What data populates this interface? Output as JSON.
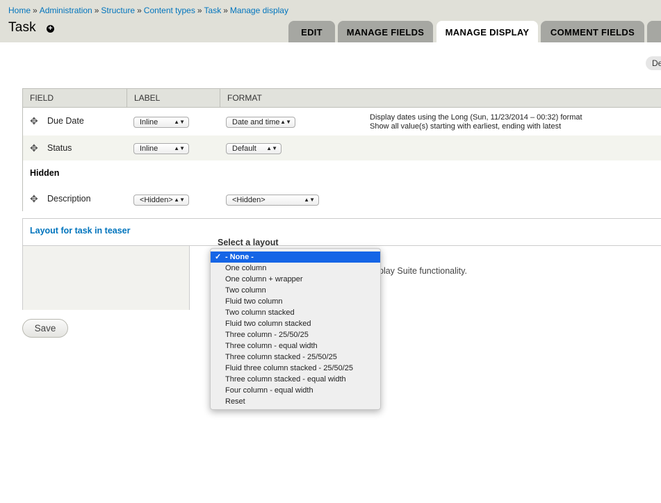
{
  "breadcrumb": [
    {
      "label": "Home"
    },
    {
      "label": "Administration"
    },
    {
      "label": "Structure"
    },
    {
      "label": "Content types"
    },
    {
      "label": "Task"
    },
    {
      "label": "Manage display"
    }
  ],
  "breadcrumb_separator": "»",
  "page": {
    "title": "Task",
    "add_shortcut_icon": "plus-circle-icon"
  },
  "tabs": [
    {
      "label": "EDIT",
      "active": false
    },
    {
      "label": "MANAGE FIELDS",
      "active": false
    },
    {
      "label": "MANAGE DISPLAY",
      "active": true
    },
    {
      "label": "COMMENT FIELDS",
      "active": false
    }
  ],
  "secondary_tab": {
    "label": "De"
  },
  "table": {
    "headers": [
      "FIELD",
      "LABEL",
      "FORMAT"
    ],
    "rows": [
      {
        "name": "Due Date",
        "label_value": "Inline",
        "format_value": "Date and time",
        "summary": [
          "Display dates using the Long (Sun, 11/23/2014 – 00:32) format",
          "Show all value(s) starting with earliest, ending with latest"
        ]
      },
      {
        "name": "Status",
        "label_value": "Inline",
        "format_value": "Default",
        "summary": []
      }
    ],
    "hidden_heading": "Hidden",
    "hidden_rows": [
      {
        "name": "Description",
        "label_value": "<Hidden>",
        "format_value": "<Hidden>"
      }
    ],
    "drag_icon": "move-cross-icon"
  },
  "layout": {
    "legend": "Layout for task in teaser",
    "select_label": "Select a layout",
    "help_text": "play Suite functionality."
  },
  "save_label": "Save",
  "dropdown": {
    "options": [
      "- None -",
      "One column",
      "One column + wrapper",
      "Two column",
      "Fluid two column",
      "Two column stacked",
      "Fluid two column stacked",
      "Three column - 25/50/25",
      "Three column - equal width",
      "Three column stacked - 25/50/25",
      "Fluid three column stacked - 25/50/25",
      "Three column stacked - equal width",
      "Four column - equal width",
      "Reset"
    ],
    "selected": "- None -",
    "check_mark": "✓",
    "colors": {
      "highlight": "#1565e6"
    }
  },
  "colors": {
    "link": "#0074bd",
    "header_bg": "#e0e0d8",
    "tab_bg": "#a6a7a2"
  }
}
